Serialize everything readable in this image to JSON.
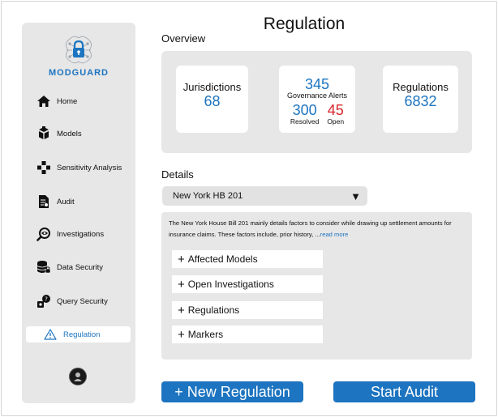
{
  "app": {
    "logo_text": "MODGUARD",
    "accent_color": "#1d74c0",
    "alert_color": "#d9252b"
  },
  "sidebar": {
    "items": [
      {
        "label": "Home",
        "icon": "home-icon"
      },
      {
        "label": "Models",
        "icon": "models-icon"
      },
      {
        "label": "Sensitivity Analysis",
        "icon": "gamepad-icon"
      },
      {
        "label": "Audit",
        "icon": "audit-document-icon"
      },
      {
        "label": "Investigations",
        "icon": "magnifier-eye-icon"
      },
      {
        "label": "Data Security",
        "icon": "database-lock-icon"
      },
      {
        "label": "Query Security",
        "icon": "query-gear-icon"
      },
      {
        "label": "Regulation",
        "icon": "warning-triangle-icon",
        "active": true
      }
    ]
  },
  "page": {
    "title": "Regulation"
  },
  "overview": {
    "label": "Overview",
    "jurisdictions": {
      "label": "Jurisdictions",
      "value": "68"
    },
    "alerts": {
      "value": "345",
      "label": "Governance Alerts",
      "resolved_value": "300",
      "resolved_label": "Resolved",
      "open_value": "45",
      "open_label": "Open"
    },
    "regulations": {
      "label": "Regulations",
      "value": "6832"
    }
  },
  "details": {
    "label": "Details",
    "selected": "New York HB 201",
    "description": "The New York House Bill 201 mainly details factors to consider while drawing up settlement amounts for insurance claims. These factors include, prior history, ...",
    "read_more": "read more",
    "sections": [
      "Affected Models",
      "Open Investigations",
      "Regulations",
      "Markers"
    ]
  },
  "actions": {
    "new_regulation": "+ New Regulation",
    "start_audit": "Start Audit"
  }
}
